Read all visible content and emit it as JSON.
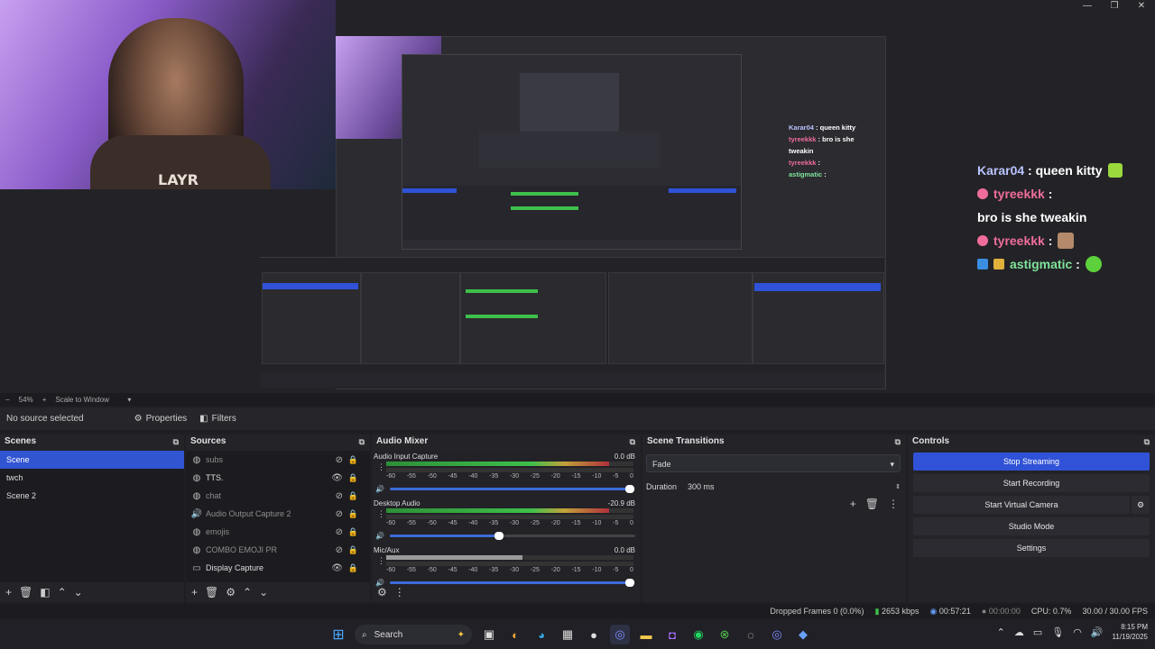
{
  "window": {
    "min": "—",
    "max": "❐",
    "close": "✕"
  },
  "preview": {
    "shirt_text": "LAYR",
    "mini_chat": [
      {
        "name": "Karar04",
        "msg": "queen kitty"
      },
      {
        "name": "tyreekkk",
        "msg": "bro is she tweakin"
      },
      {
        "name": "tyreekkk",
        "msg": ""
      },
      {
        "name": "astigmatic",
        "msg": ""
      }
    ]
  },
  "chat": {
    "line1": {
      "name": "Karar04",
      "sep": ":",
      "msg": "queen kitty"
    },
    "line2": {
      "name": "tyreekkk",
      "sep": ":",
      "msg": "bro is she tweakin"
    },
    "line3": {
      "name": "tyreekkk",
      "sep": ":"
    },
    "line4": {
      "name": "astigmatic",
      "sep": ":"
    }
  },
  "zoombar": {
    "minus": "−",
    "zoom": "54%",
    "plus": "+",
    "mode": "Scale to Window"
  },
  "source_toolbar": {
    "none_selected": "No source selected",
    "properties": "Properties",
    "filters": "Filters"
  },
  "scenes": {
    "title": "Scenes",
    "items": [
      "Scene",
      "twch",
      "Scene 2"
    ]
  },
  "sources": {
    "title": "Sources",
    "items": [
      {
        "icon": "◍",
        "label": "subs"
      },
      {
        "icon": "◍",
        "label": "TTS."
      },
      {
        "icon": "◍",
        "label": "chat"
      },
      {
        "icon": "🔊",
        "label": "Audio Output Capture 2"
      },
      {
        "icon": "◍",
        "label": "emojis"
      },
      {
        "icon": "◍",
        "label": "COMBO EMOJI PR"
      },
      {
        "icon": "▭",
        "label": "Display Capture"
      }
    ]
  },
  "mixer": {
    "title": "Audio Mixer",
    "scale": [
      "-60",
      "-55",
      "-50",
      "-45",
      "-40",
      "-35",
      "-30",
      "-25",
      "-20",
      "-15",
      "-10",
      "-5",
      "0"
    ],
    "channels": [
      {
        "name": "Audio Input Capture",
        "db": "0.0 dB",
        "level": 0.98
      },
      {
        "name": "Desktop Audio",
        "db": "-20.9 dB",
        "level": 0.45
      },
      {
        "name": "Mic/Aux",
        "db": "0.0 dB",
        "level": 0.98
      }
    ]
  },
  "transitions": {
    "title": "Scene Transitions",
    "selected": "Fade",
    "duration_label": "Duration",
    "duration_value": "300 ms"
  },
  "controls": {
    "title": "Controls",
    "stop_streaming": "Stop Streaming",
    "start_recording": "Start Recording",
    "start_virtual_camera": "Start Virtual Camera",
    "studio_mode": "Studio Mode",
    "settings": "Settings"
  },
  "status": {
    "dropped": "Dropped Frames 0 (0.0%)",
    "kbps": "2653 kbps",
    "stream_time": "00:57:21",
    "rec_time": "00:00:00",
    "cpu": "CPU: 0.7%",
    "fps": "30.00 / 30.00 FPS"
  },
  "taskbar": {
    "search": "Search",
    "time": "8:15 PM",
    "date": "11/19/2025"
  }
}
